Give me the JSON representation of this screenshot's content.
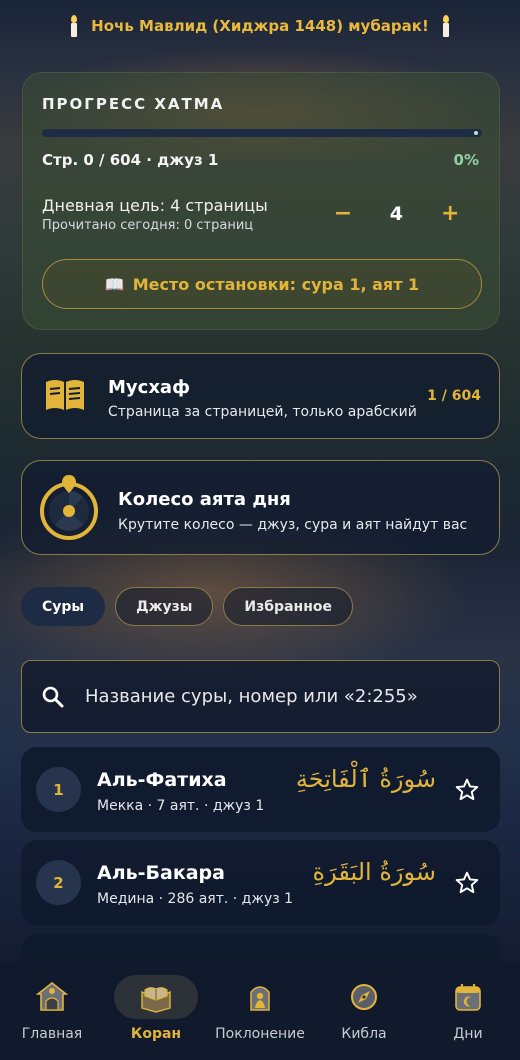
{
  "banner": {
    "text": "Ночь Мавлид (Хиджра 1448) мубарак!"
  },
  "progress": {
    "title": "ПРОГРЕСС ХАТМА",
    "fraction": 0,
    "page_info": "Стр. 0 / 604 · джуз 1",
    "percent": "0%",
    "daily_goal": "Дневная цель: 4 страницы",
    "read_today": "Прочитано сегодня: 0 страниц",
    "goal_minus": "−",
    "goal_value": "4",
    "goal_plus": "+",
    "bookmark_icon": "📖",
    "bookmark_label": "Место остановки: сура 1, аят 1"
  },
  "mushaf": {
    "title": "Мусхаф",
    "subtitle": "Страница за страницей, только арабский",
    "count": "1 / 604",
    "icon": "open-book-icon"
  },
  "wheel": {
    "title": "Колесо аята дня",
    "subtitle": "Крутите колесо — джуз, сура и аят найдут вас",
    "icon": "wheel-icon"
  },
  "tabs": [
    {
      "label": "Суры",
      "active": true
    },
    {
      "label": "Джузы",
      "active": false
    },
    {
      "label": "Избранное",
      "active": false
    }
  ],
  "search": {
    "placeholder": "Название суры, номер или «2:255»",
    "icon": "search-icon"
  },
  "suras": [
    {
      "number": "1",
      "name": "Аль-Фатиха",
      "meta": "Мекка · 7 аят. · джуз 1",
      "arabic": "سُورَةُ ٱلْفَاتِحَةِ"
    },
    {
      "number": "2",
      "name": "Аль-Бакара",
      "meta": "Медина · 286 аят. · джуз 1",
      "arabic": "سُورَةُ البَقَرَةِ"
    }
  ],
  "nav": [
    {
      "label": "Главная",
      "icon": "home-mosque-icon",
      "active": false
    },
    {
      "label": "Коран",
      "icon": "quran-icon",
      "active": true
    },
    {
      "label": "Поклонение",
      "icon": "prayer-icon",
      "active": false
    },
    {
      "label": "Кибла",
      "icon": "compass-icon",
      "active": false
    },
    {
      "label": "Дни",
      "icon": "calendar-icon",
      "active": false
    }
  ],
  "colors": {
    "accent": "#e2b43a",
    "card": "#121c30",
    "nav": "#101a2c",
    "percent": "#8fd0a8"
  }
}
